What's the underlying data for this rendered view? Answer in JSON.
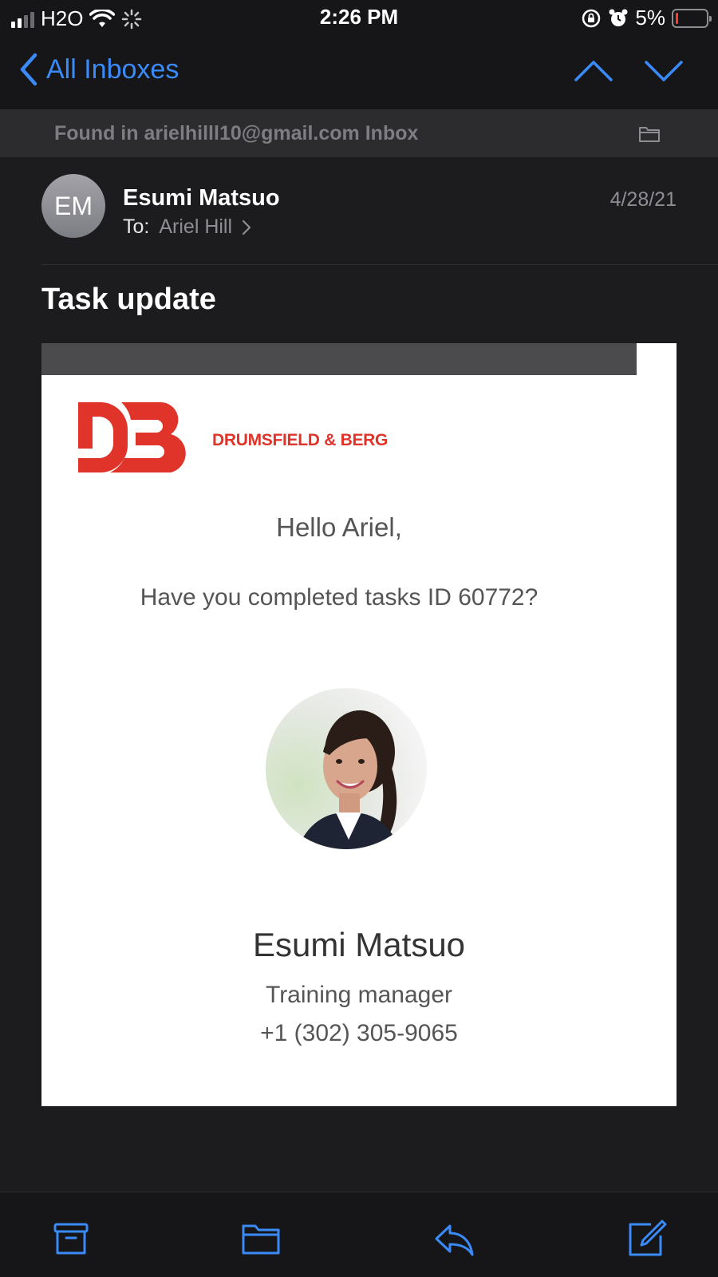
{
  "status_bar": {
    "carrier": "H2O",
    "time": "2:26 PM",
    "battery_percent": "5%",
    "battery_level": 0.05,
    "icons": [
      "signal-icon",
      "wifi-icon",
      "activity-spinner-icon",
      "orientation-lock-icon",
      "alarm-icon",
      "battery-icon"
    ]
  },
  "nav": {
    "back_label": "All Inboxes",
    "icons": [
      "chevron-left-icon",
      "chevron-up-icon",
      "chevron-down-icon"
    ]
  },
  "banner": {
    "found_text": "Found in arielhilll10@gmail.com Inbox",
    "icon": "folder-icon"
  },
  "message": {
    "avatar_initials": "EM",
    "sender": "Esumi Matsuo",
    "to_label": "To:",
    "to_name": "Ariel Hill",
    "date": "4/28/21",
    "subject": "Task update"
  },
  "email_body": {
    "brand_name": "DRUMSFIELD & BERG",
    "logo_text": "DB",
    "greeting": "Hello Ariel,",
    "question": "Have you completed tasks ID 60772?",
    "signature_name": "Esumi Matsuo",
    "signature_title": "Training manager",
    "signature_phone": "+1 (302) 305-9065"
  },
  "toolbar": {
    "icons": [
      "archive-icon",
      "folder-move-icon",
      "reply-icon",
      "compose-icon"
    ]
  },
  "colors": {
    "accent": "#3a8bf7",
    "brand_red": "#e0342a",
    "background": "#1c1c1e"
  }
}
